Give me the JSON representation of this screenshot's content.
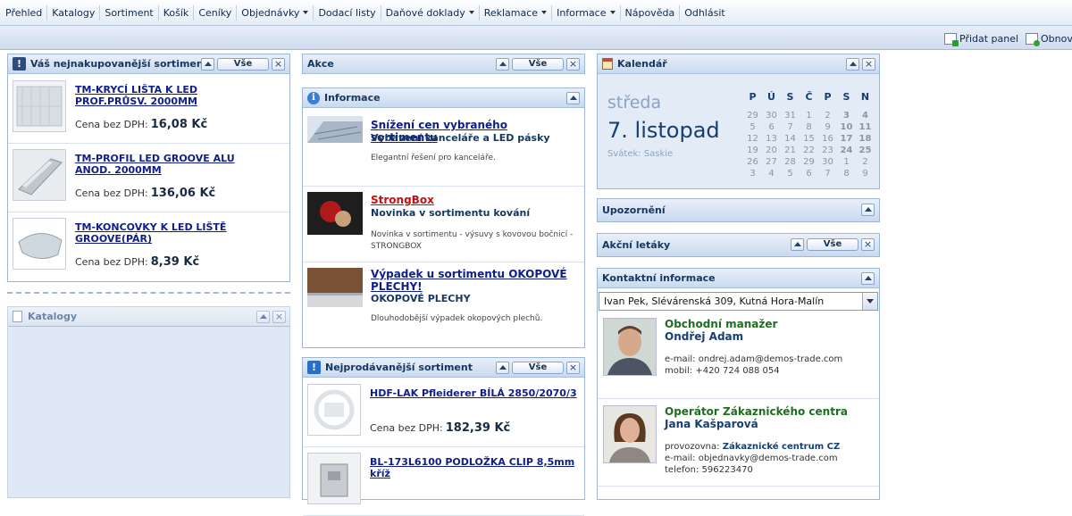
{
  "menu": [
    {
      "label": "Přehled",
      "dropdown": false
    },
    {
      "label": "Katalogy",
      "dropdown": false
    },
    {
      "label": "Sortiment",
      "dropdown": false
    },
    {
      "label": "Košík",
      "dropdown": false
    },
    {
      "label": "Ceníky",
      "dropdown": false
    },
    {
      "label": "Objednávky",
      "dropdown": true
    },
    {
      "label": "Dodací listy",
      "dropdown": false
    },
    {
      "label": "Daňové doklady",
      "dropdown": true
    },
    {
      "label": "Reklamace",
      "dropdown": true
    },
    {
      "label": "Informace",
      "dropdown": true
    },
    {
      "label": "Nápověda",
      "dropdown": false
    },
    {
      "label": "Odhlásit",
      "dropdown": false
    }
  ],
  "toolbar": {
    "add_panel": "Přidat panel",
    "refresh": "Obnovi"
  },
  "common": {
    "all_label": "Vše",
    "close_label": "×"
  },
  "top_purchased": {
    "title": "Váš nejnakupovanější sortiment",
    "price_label": "Cena bez DPH:",
    "items": [
      {
        "name": "TM-KRYCÍ LIŠTA K LED PROF.PRŮSV. 2000MM",
        "price": "16,08 Kč"
      },
      {
        "name": "TM-PROFIL LED GROOVE ALU ANOD. 2000MM",
        "price": "136,06 Kč"
      },
      {
        "name": "TM-KONCOVKY K LED LIŠTĚ GROOVE(PÁR)",
        "price": "8,39 Kč"
      }
    ]
  },
  "catalogs": {
    "title": "Katalogy"
  },
  "promo": {
    "title": "Akce"
  },
  "info": {
    "title": "Informace",
    "items": [
      {
        "title": "Snížení cen vybraného sortimentu",
        "subtitle": "Vybavení kanceláře a LED pásky",
        "desc": "Elegantní řešení pro kanceláře."
      },
      {
        "title": "StrongBox",
        "subtitle": "Novinka v sortimentu kování",
        "desc": "Novinka v sortimentu - výsuvy s kovovou bočnicí - STRONGBOX"
      },
      {
        "title": "Výpadek u sortimentu OKOPOVÉ PLECHY!",
        "subtitle": "OKOPOVÉ PLECHY",
        "desc": "Dlouhodobější výpadek okopových plechů."
      }
    ]
  },
  "bestsellers": {
    "title": "Nejprodávanější sortiment",
    "price_label": "Cena bez DPH:",
    "items": [
      {
        "name": "HDF-LAK Pfleiderer BÍLÁ 2850/2070/3",
        "price": "182,39 Kč"
      },
      {
        "name": "BL-173L6100 PODLOŽKA CLIP 8,5mm kříž",
        "price": ""
      }
    ]
  },
  "calendar": {
    "title": "Kalendář",
    "weekday": "středa",
    "date": "7. listopad",
    "nameday": "Svátek: Saskie",
    "headers": [
      "P",
      "Ú",
      "S",
      "Č",
      "P",
      "S",
      "N"
    ],
    "weeks": [
      [
        "29",
        "30",
        "31",
        "1",
        "2",
        "3",
        "4"
      ],
      [
        "5",
        "6",
        "7",
        "8",
        "9",
        "10",
        "11"
      ],
      [
        "12",
        "13",
        "14",
        "15",
        "16",
        "17",
        "18"
      ],
      [
        "19",
        "20",
        "21",
        "22",
        "23",
        "24",
        "25"
      ],
      [
        "26",
        "27",
        "28",
        "29",
        "30",
        "1",
        "2"
      ],
      [
        "3",
        "4",
        "5",
        "6",
        "7",
        "8",
        "9"
      ]
    ]
  },
  "notices": {
    "title": "Upozornění"
  },
  "leaflets": {
    "title": "Akční letáky"
  },
  "contacts": {
    "title": "Kontaktní informace",
    "selected": "Ivan Pek, Slévárenská 309, Kutná Hora-Malín",
    "people": [
      {
        "role": "Obchodní manažer",
        "name": "Ondřej Adam",
        "lines": [
          {
            "label": "e-mail:",
            "value": "ondrej.adam@demos-trade.com",
            "bold": false
          },
          {
            "label": "mobil:",
            "value": "+420 724 088 054",
            "bold": false
          }
        ]
      },
      {
        "role": "Operátor Zákaznického centra",
        "name": "Jana Kašparová",
        "lines": [
          {
            "label": "provozovna:",
            "value": "Zákaznické centrum CZ",
            "bold": true
          },
          {
            "label": "e-mail:",
            "value": "objednavky@demos-trade.com",
            "bold": false
          },
          {
            "label": "telefon:",
            "value": "596223470",
            "bold": false
          }
        ]
      }
    ]
  }
}
